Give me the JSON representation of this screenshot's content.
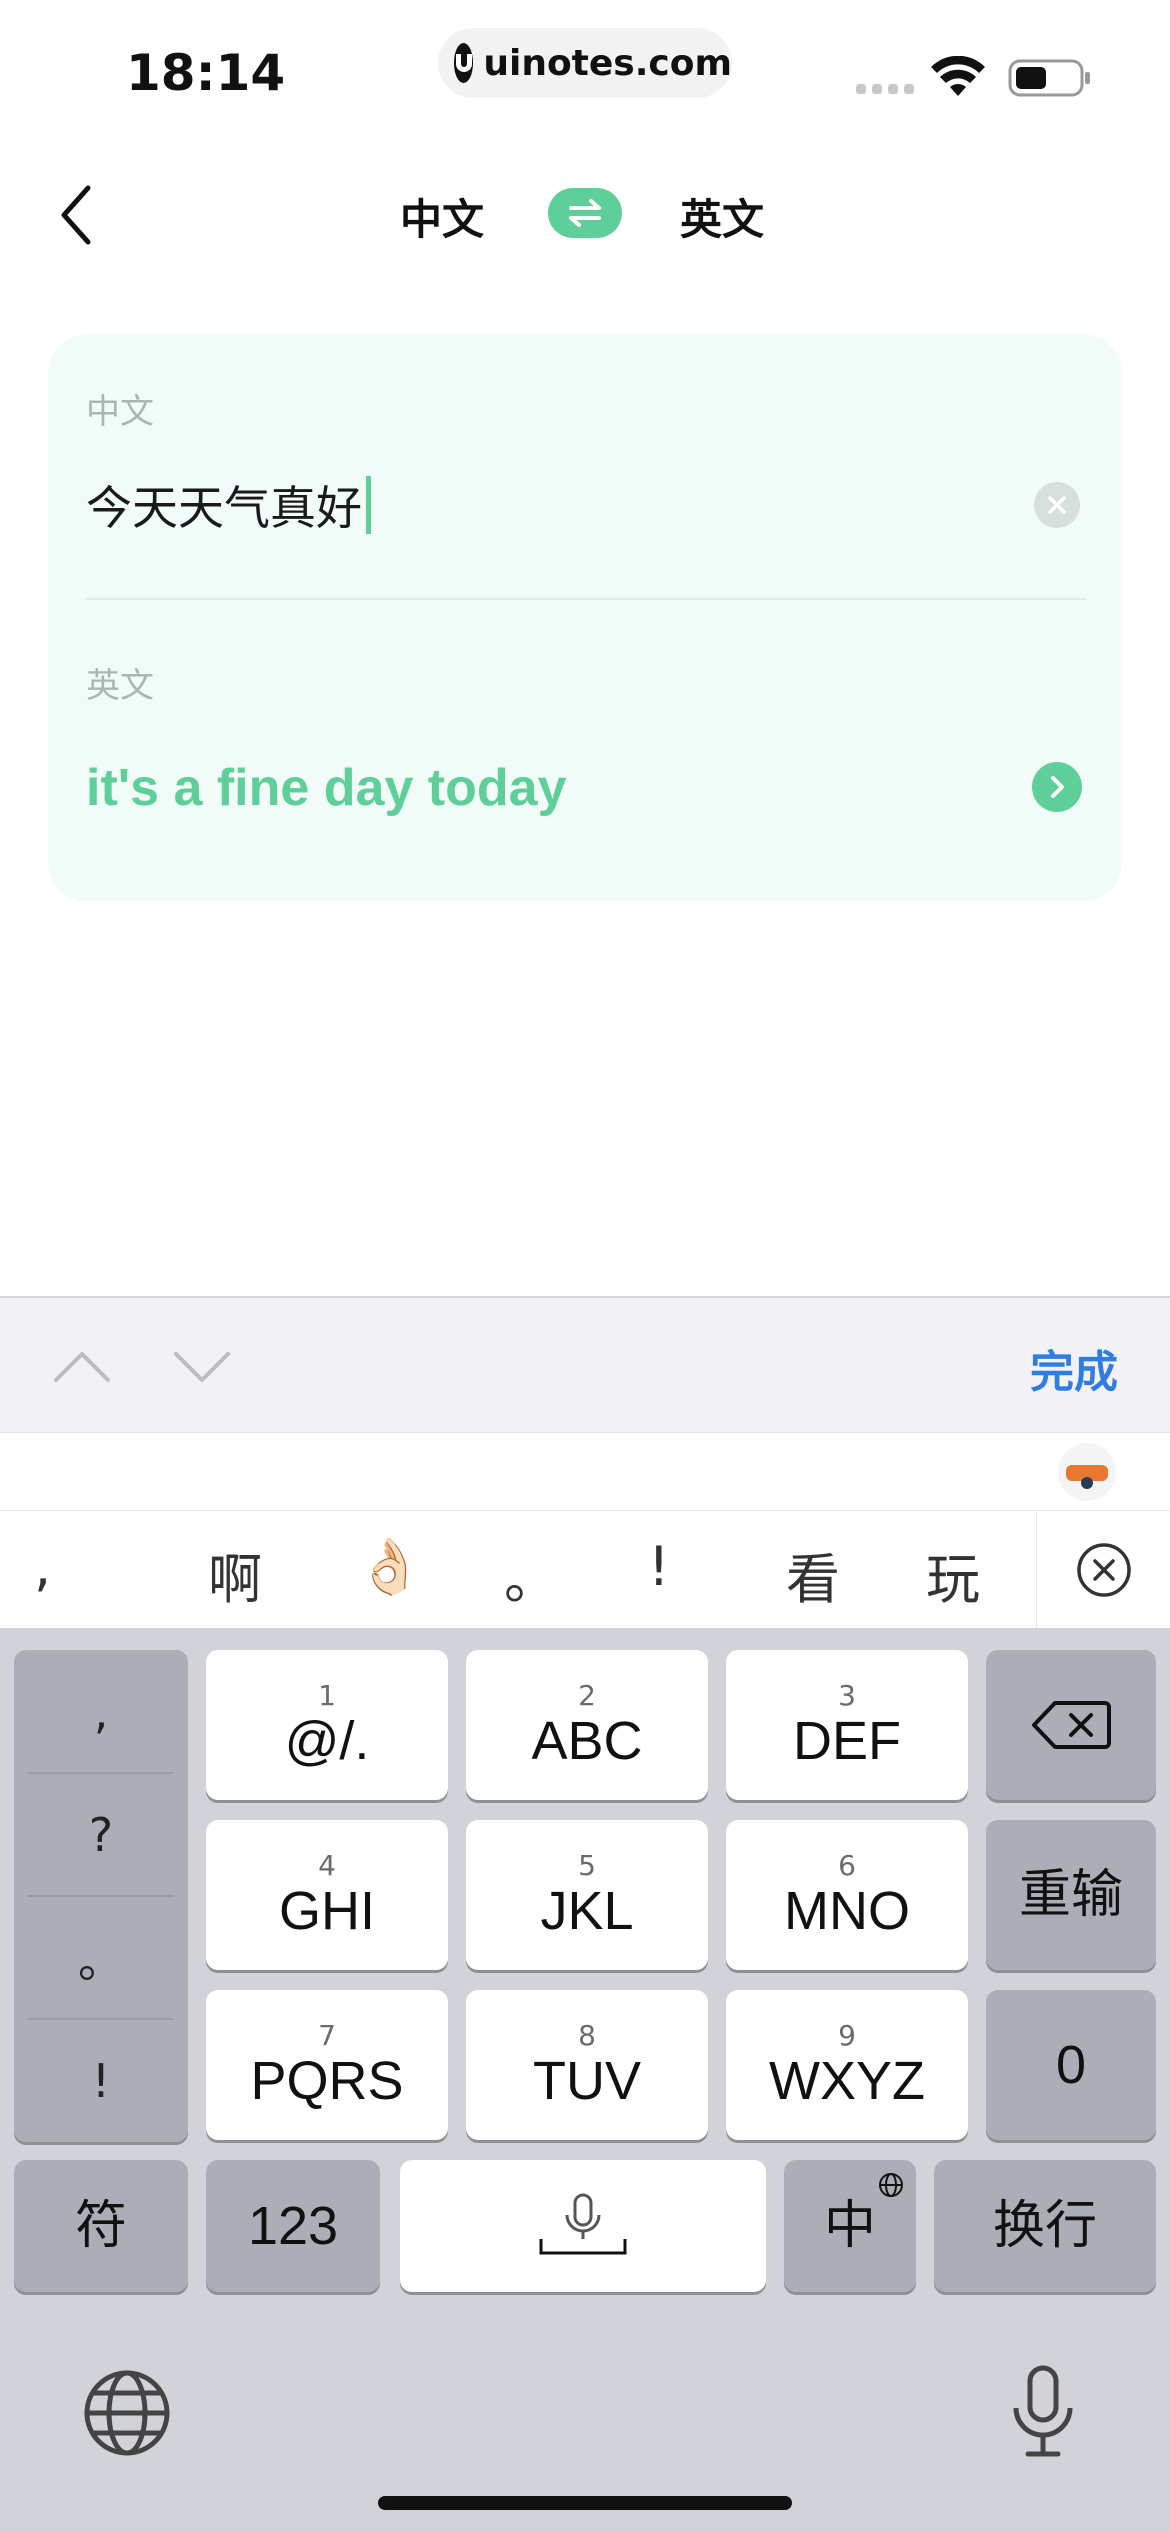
{
  "status_bar": {
    "time": "18:14",
    "url": "uinotes.com"
  },
  "nav": {
    "source_lang": "中文",
    "target_lang": "英文"
  },
  "card": {
    "source_label": "中文",
    "source_text": "今天天气真好",
    "target_label": "英文",
    "target_text": "it's a fine day today"
  },
  "toolbar": {
    "done_label": "完成"
  },
  "candidates": [
    ",",
    "啊",
    "👌🏻",
    "。",
    "!",
    "看",
    "玩"
  ],
  "keyboard": {
    "punctuation": [
      ",",
      "?",
      "。",
      "!"
    ],
    "keys": [
      {
        "num": "1",
        "label": "@/."
      },
      {
        "num": "2",
        "label": "ABC"
      },
      {
        "num": "3",
        "label": "DEF"
      },
      {
        "num": "4",
        "label": "GHI"
      },
      {
        "num": "5",
        "label": "JKL"
      },
      {
        "num": "6",
        "label": "MNO"
      },
      {
        "num": "7",
        "label": "PQRS"
      },
      {
        "num": "8",
        "label": "TUV"
      },
      {
        "num": "9",
        "label": "WXYZ"
      }
    ],
    "reinput_label": "重输",
    "zero_label": "0",
    "symbols_label": "符",
    "numbers_label": "123",
    "lang_label": "中",
    "return_label": "换行"
  },
  "colors": {
    "accent": "#5fcf9a",
    "done_blue": "#2f7de1",
    "card_bg": "#f1fbf7"
  }
}
